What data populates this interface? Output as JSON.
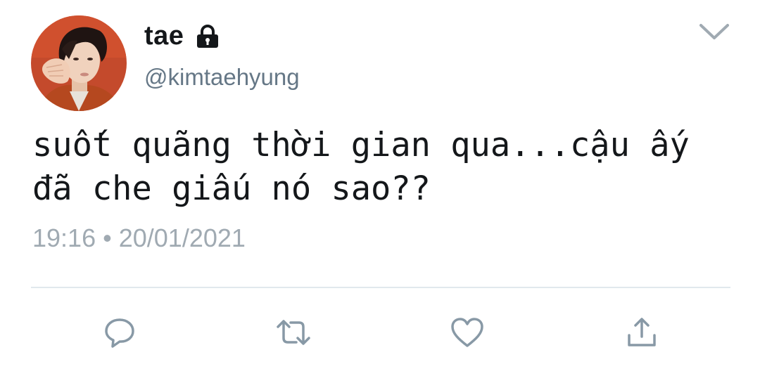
{
  "user": {
    "display_name": "tae",
    "handle": "@kimtaehyung",
    "protected_icon": "lock-icon",
    "avatar_icon": "profile-photo"
  },
  "tweet": {
    "text": "suốt quãng thời gian qua...cậu ấy\nđã che giấu nó sao??",
    "time": "19:16",
    "separator": "•",
    "date": "20/01/2021"
  },
  "menu": {
    "icon": "chevron-down-icon"
  },
  "actions": [
    {
      "name": "reply",
      "icon": "reply-icon"
    },
    {
      "name": "retweet",
      "icon": "retweet-icon"
    },
    {
      "name": "like",
      "icon": "heart-icon"
    },
    {
      "name": "share",
      "icon": "share-icon"
    }
  ],
  "colors": {
    "text": "#14171a",
    "secondary": "#657786",
    "muted": "#a0aab2",
    "icon": "#8899a6",
    "divider": "#e1e8ed",
    "avatar_bg": "#c8462a"
  }
}
